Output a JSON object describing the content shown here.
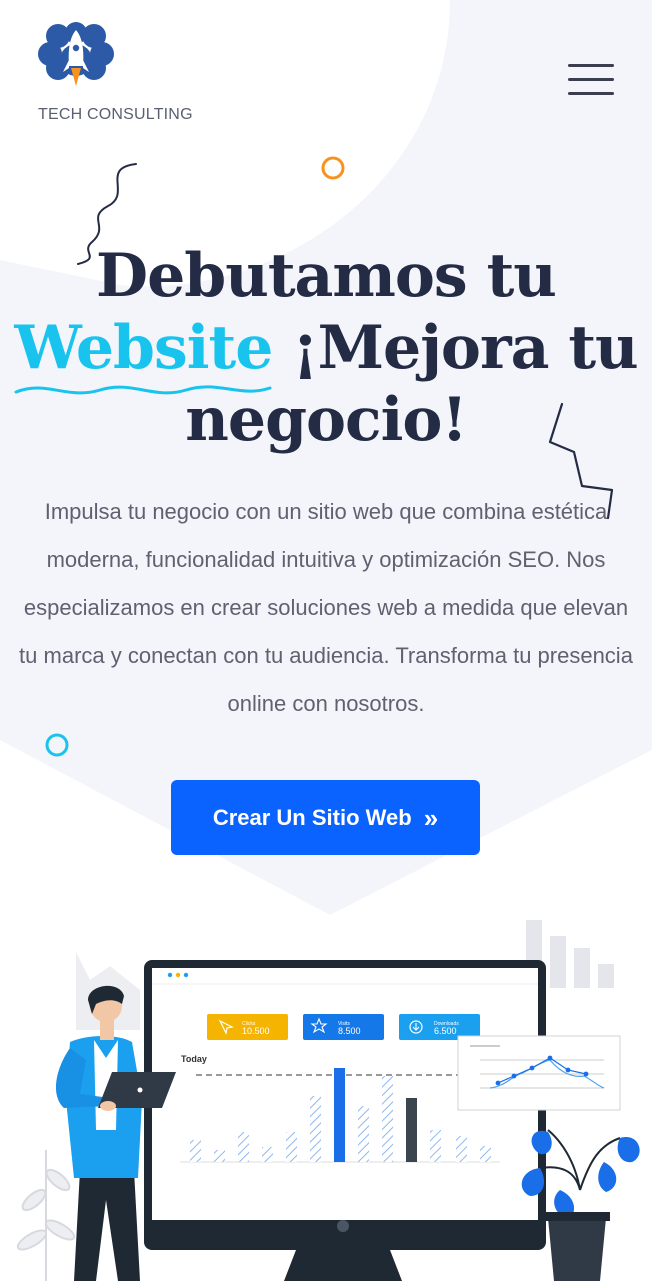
{
  "brand": {
    "name": "TECH CONSULTING",
    "logo_icon": "brain-rocket-icon"
  },
  "nav": {
    "menu_icon": "hamburger-menu-icon"
  },
  "hero": {
    "title_line1": "Debutamos tu",
    "title_accent": "Website",
    "title_rest": " ¡Mejora tu",
    "title_line3": "negocio!",
    "description": "Impulsa tu negocio con un sitio web que combina estética moderna, funcionalidad intuitiva y optimización SEO. Nos especializamos en crear soluciones web a medida que elevan tu marca y conectan con tu audiencia. Transforma tu presencia online con nosotros.",
    "cta_label": "Crear Un Sitio Web",
    "cta_icon": "double-chevron-right-icon"
  },
  "illustration": {
    "today_label": "Today",
    "stat_cards": [
      {
        "value": "10.500",
        "color": "#f5b400",
        "icon": "cursor-icon"
      },
      {
        "value": "8.500",
        "color": "#1578e8",
        "icon": "star-icon"
      },
      {
        "value": "6.500",
        "color": "#1ba0f0",
        "icon": "download-icon"
      }
    ]
  },
  "colors": {
    "accent": "#18c4ee",
    "primary_button": "#0a63ff",
    "heading": "#232b45",
    "orange_ring": "#f7921e"
  }
}
